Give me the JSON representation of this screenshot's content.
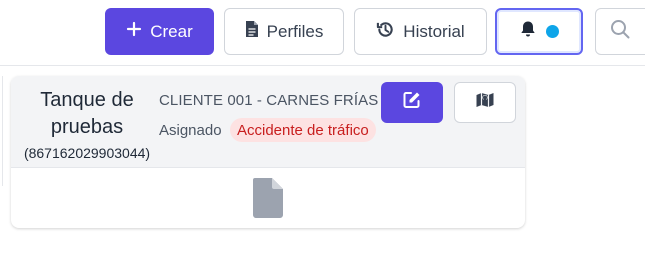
{
  "toolbar": {
    "create_label": "Crear",
    "profiles_label": "Perfiles",
    "history_label": "Historial"
  },
  "card": {
    "tank_name": "Tanque de pruebas",
    "tank_id": "(867162029903044)",
    "client": "CLIENTE 001 - CARNES FRÍAS",
    "status_label": "Asignado",
    "incident_badge": "Accidente de tráfico"
  },
  "icons": {
    "create": "plus-icon",
    "profiles": "file-icon",
    "history": "history-icon",
    "notifications": "bell-icon",
    "search": "search-icon",
    "edit": "edit-icon",
    "map": "map-icon",
    "document": "document-icon"
  },
  "colors": {
    "primary": "#5b47e0",
    "notification_dot": "#0ea5e9",
    "badge_bg": "#fde2e2",
    "badge_text": "#c81e1e"
  }
}
